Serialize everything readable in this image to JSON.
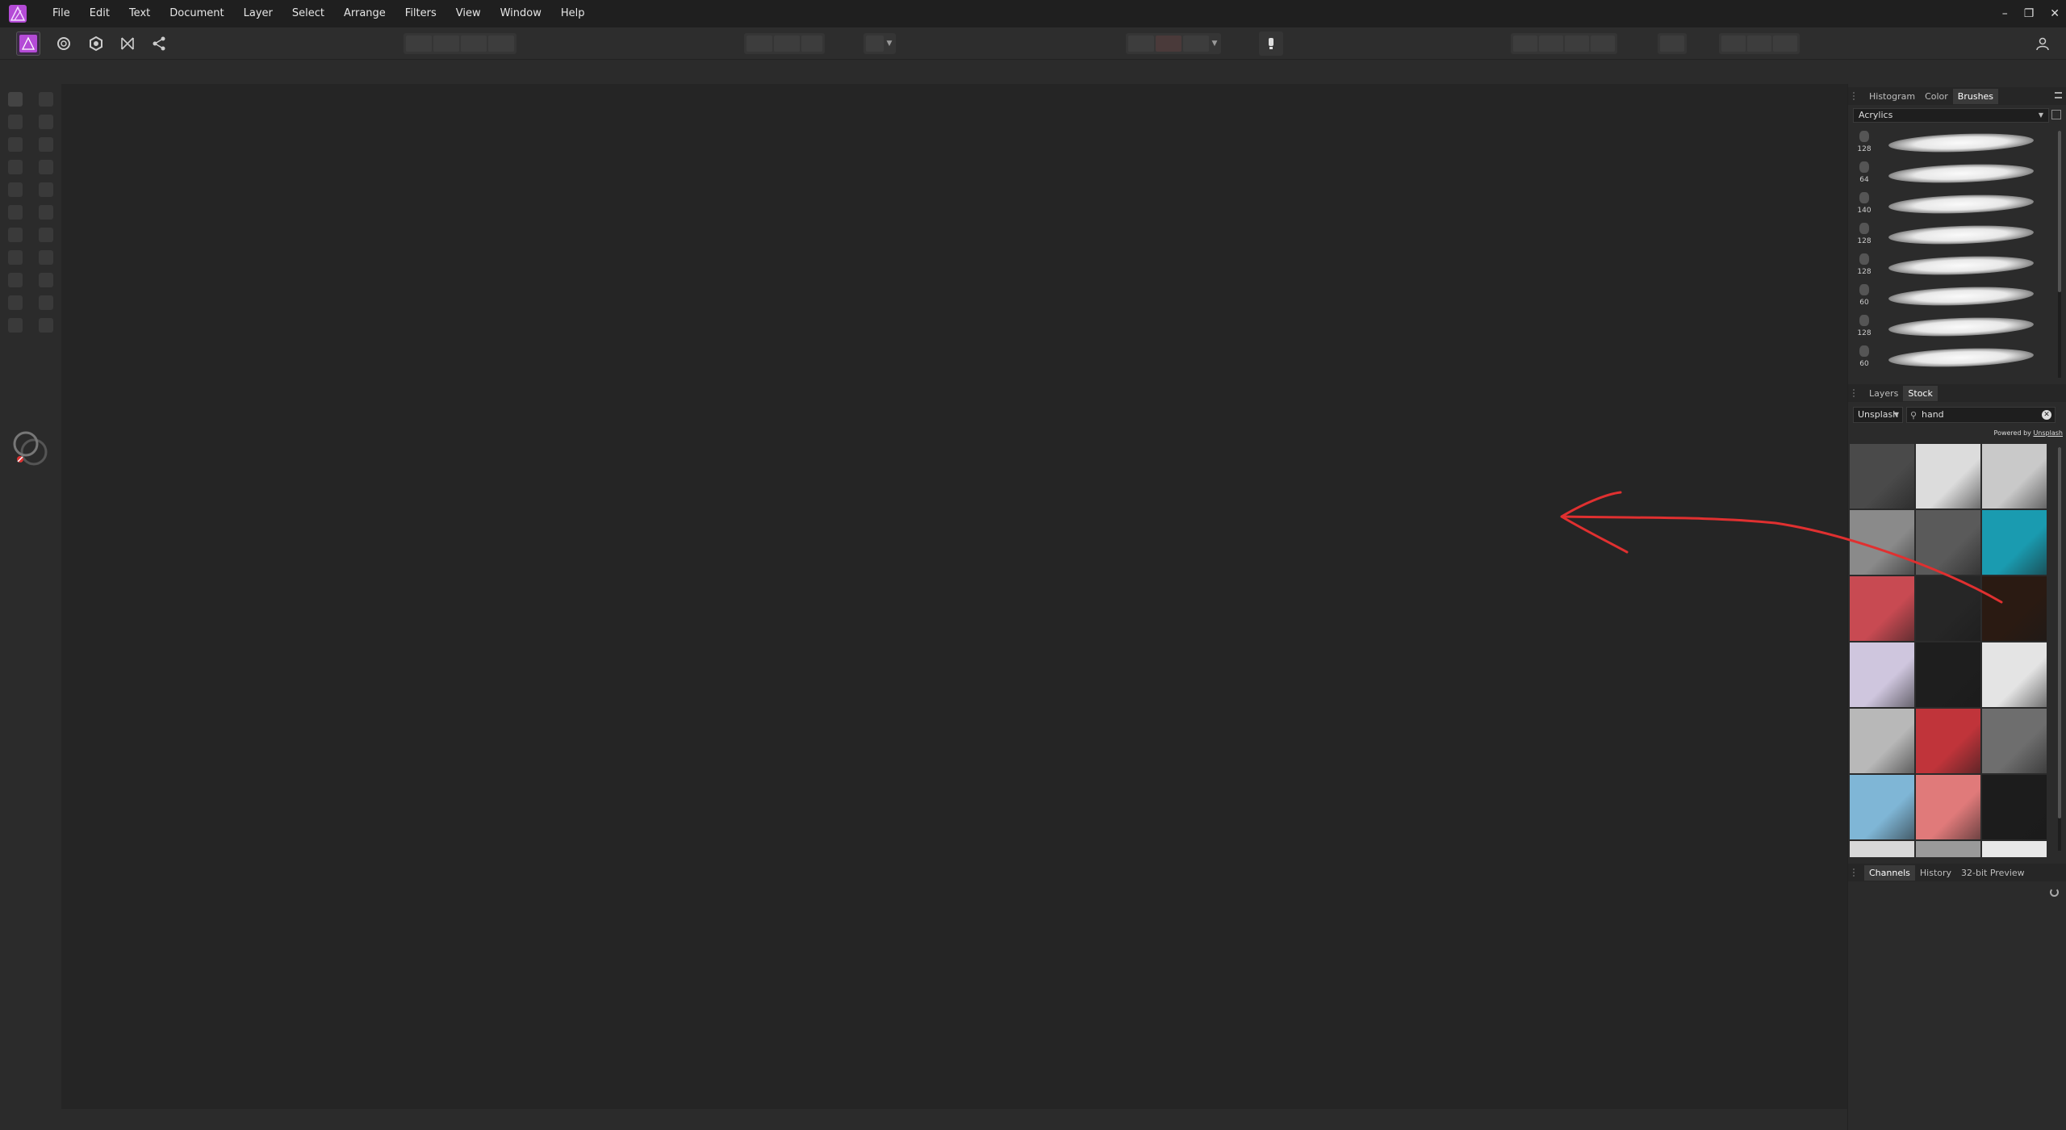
{
  "menubar": {
    "items": [
      "File",
      "Edit",
      "Text",
      "Document",
      "Layer",
      "Select",
      "Arrange",
      "Filters",
      "View",
      "Window",
      "Help"
    ],
    "window_controls": {
      "minimize": "–",
      "restore": "❐",
      "close": "✕"
    }
  },
  "colors": {
    "accent": "#b44bd6",
    "annotation": "#e03030",
    "panel_bg": "#2b2b2b",
    "canvas_bg": "#252525"
  },
  "brushes_panel": {
    "tabs": [
      "Histogram",
      "Color",
      "Brushes"
    ],
    "active_tab": "Brushes",
    "category": "Acrylics",
    "sizes": [
      "128",
      "64",
      "140",
      "128",
      "128",
      "60",
      "128",
      "60"
    ]
  },
  "stock_panel": {
    "tabs": [
      "Layers",
      "Stock"
    ],
    "active_tab": "Stock",
    "source": "Unsplash",
    "search_value": "hand",
    "powered_by_prefix": "Powered by ",
    "powered_by_link": "Unsplash",
    "thumbnails": [
      "#4a4a4a",
      "#dcdcdc",
      "#c9c9c9",
      "#8a8a8a",
      "#5a5a5a",
      "#1a9bb0",
      "#c84a52",
      "#262626",
      "#2a1a12",
      "#cfc6de",
      "#1e1e1e",
      "#e4e4e4",
      "#b8b8b8",
      "#c0343a",
      "#6e6e6e",
      "#7fb6d6",
      "#e07a7a",
      "#1c1c1c",
      "#d8d8d8",
      "#9a9a9a",
      "#e8e8e8"
    ]
  },
  "bottom_panel": {
    "tabs": [
      "Channels",
      "History",
      "32-bit Preview"
    ],
    "active_tab": "Channels"
  },
  "icons": {
    "persona": [
      "photo-persona-icon",
      "liquify-persona-icon",
      "develop-persona-icon",
      "tone-mapping-persona-icon",
      "export-persona-icon"
    ],
    "user": "user-icon"
  }
}
